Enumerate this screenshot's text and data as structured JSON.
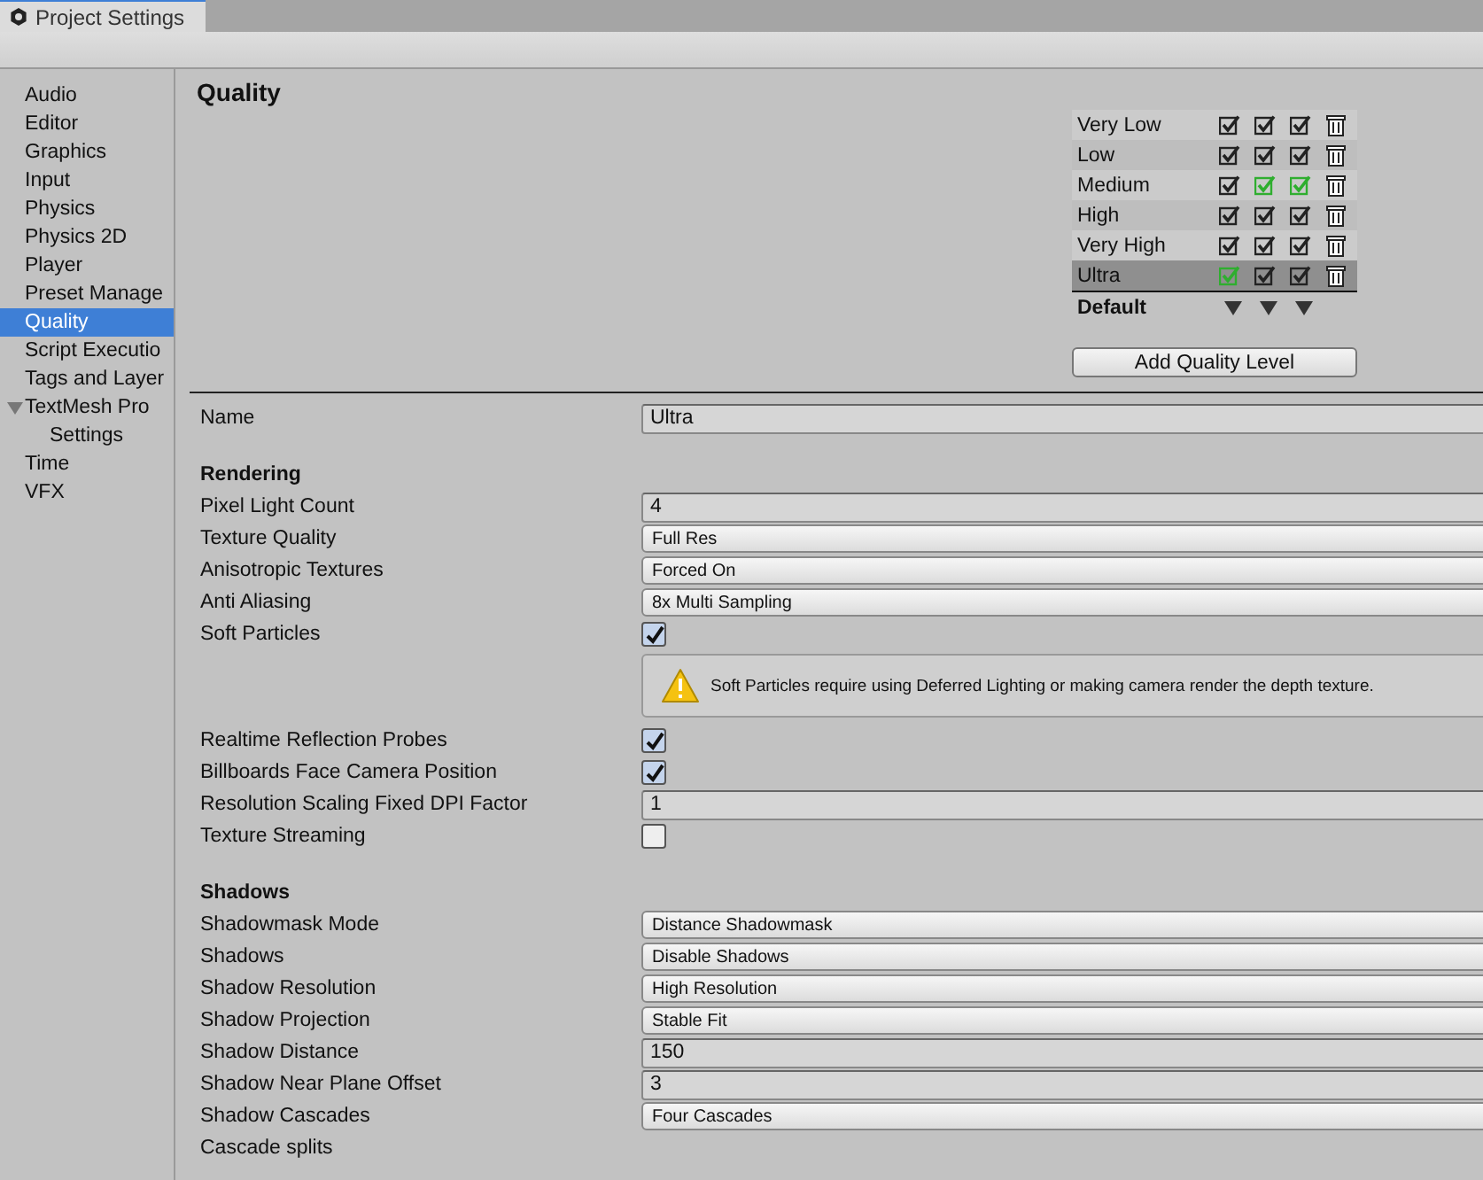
{
  "window": {
    "title": "Project Settings"
  },
  "sidebar": {
    "items": [
      {
        "label": "Audio",
        "selected": false
      },
      {
        "label": "Editor",
        "selected": false
      },
      {
        "label": "Graphics",
        "selected": false
      },
      {
        "label": "Input",
        "selected": false
      },
      {
        "label": "Physics",
        "selected": false
      },
      {
        "label": "Physics 2D",
        "selected": false
      },
      {
        "label": "Player",
        "selected": false
      },
      {
        "label": "Preset Manage",
        "selected": false
      },
      {
        "label": "Quality",
        "selected": true
      },
      {
        "label": "Script Executio",
        "selected": false
      },
      {
        "label": "Tags and Layer",
        "selected": false
      },
      {
        "label": "TextMesh Pro",
        "selected": false,
        "expanded": true,
        "children": [
          {
            "label": "Settings",
            "selected": false
          }
        ]
      },
      {
        "label": "Time",
        "selected": false
      },
      {
        "label": "VFX",
        "selected": false
      }
    ]
  },
  "page_title": "Quality",
  "quality_levels": {
    "rows": [
      {
        "name": "Very Low",
        "selected": false,
        "checks": [
          {
            "checked": true,
            "default": false
          },
          {
            "checked": true,
            "default": false
          },
          {
            "checked": true,
            "default": false
          }
        ]
      },
      {
        "name": "Low",
        "selected": false,
        "checks": [
          {
            "checked": true,
            "default": false
          },
          {
            "checked": true,
            "default": false
          },
          {
            "checked": true,
            "default": false
          }
        ]
      },
      {
        "name": "Medium",
        "selected": false,
        "checks": [
          {
            "checked": true,
            "default": false
          },
          {
            "checked": true,
            "default": true
          },
          {
            "checked": true,
            "default": true
          }
        ]
      },
      {
        "name": "High",
        "selected": false,
        "checks": [
          {
            "checked": true,
            "default": false
          },
          {
            "checked": true,
            "default": false
          },
          {
            "checked": true,
            "default": false
          }
        ]
      },
      {
        "name": "Very High",
        "selected": false,
        "checks": [
          {
            "checked": true,
            "default": false
          },
          {
            "checked": true,
            "default": false
          },
          {
            "checked": true,
            "default": false
          }
        ]
      },
      {
        "name": "Ultra",
        "selected": true,
        "checks": [
          {
            "checked": true,
            "default": true
          },
          {
            "checked": true,
            "default": false
          },
          {
            "checked": true,
            "default": false
          }
        ]
      }
    ],
    "default_label": "Default",
    "add_button": "Add Quality Level"
  },
  "settings": [
    {
      "kind": "field",
      "label": "Name",
      "value": "Ultra"
    },
    {
      "kind": "gap"
    },
    {
      "kind": "heading",
      "label": "Rendering"
    },
    {
      "kind": "field",
      "label": "Pixel Light Count",
      "value": "4"
    },
    {
      "kind": "dropdown",
      "label": "Texture Quality",
      "value": "Full Res"
    },
    {
      "kind": "dropdown",
      "label": "Anisotropic Textures",
      "value": "Forced On"
    },
    {
      "kind": "dropdown",
      "label": "Anti Aliasing",
      "value": "8x Multi Sampling"
    },
    {
      "kind": "checkbox",
      "label": "Soft Particles",
      "checked": true
    },
    {
      "kind": "warning",
      "text": "Soft Particles require using Deferred Lighting or making camera render the depth texture."
    },
    {
      "kind": "checkbox",
      "label": "Realtime Reflection Probes",
      "checked": true
    },
    {
      "kind": "checkbox",
      "label": "Billboards Face Camera Position",
      "checked": true
    },
    {
      "kind": "field",
      "label": "Resolution Scaling Fixed DPI Factor",
      "value": "1"
    },
    {
      "kind": "checkbox",
      "label": "Texture Streaming",
      "checked": false
    },
    {
      "kind": "gap"
    },
    {
      "kind": "heading",
      "label": "Shadows"
    },
    {
      "kind": "dropdown",
      "label": "Shadowmask Mode",
      "value": "Distance Shadowmask"
    },
    {
      "kind": "dropdown",
      "label": "Shadows",
      "value": "Disable Shadows"
    },
    {
      "kind": "dropdown",
      "label": "Shadow Resolution",
      "value": "High Resolution"
    },
    {
      "kind": "dropdown",
      "label": "Shadow Projection",
      "value": "Stable Fit"
    },
    {
      "kind": "field",
      "label": "Shadow Distance",
      "value": "150"
    },
    {
      "kind": "field",
      "label": "Shadow Near Plane Offset",
      "value": "3"
    },
    {
      "kind": "dropdown",
      "label": "Shadow Cascades",
      "value": "Four Cascades"
    },
    {
      "kind": "label",
      "label": "Cascade splits"
    }
  ]
}
